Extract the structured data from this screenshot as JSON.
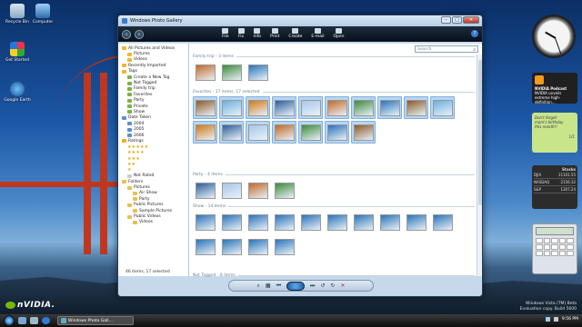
{
  "desktop": {
    "icons": [
      {
        "label": "Recycle Bin"
      },
      {
        "label": "Computer"
      },
      {
        "label": "Get Started"
      },
      {
        "label": "Google Earth"
      }
    ],
    "brand": "nVIDIA.",
    "watermark": [
      "Windows Vista (TM) Beta",
      "Evaluation copy. Build 5600"
    ]
  },
  "gadgets": {
    "podcast": {
      "title": "NVIDIA Podcast",
      "text": "NVIDIA unveils extreme high-definition..."
    },
    "note": {
      "lines": [
        "Don't forget",
        "mom's birthday",
        "this month!!"
      ],
      "pager": "1/1"
    },
    "stocks": {
      "title": "Stocks",
      "rows": [
        {
          "symbol": "DJIA",
          "value": "11101.55"
        },
        {
          "symbol": "NASDAQ",
          "value": "2156.32"
        },
        {
          "symbol": "S&P",
          "value": "1307.24"
        }
      ]
    }
  },
  "taskbar": {
    "active_task": "Windows Photo Gall...",
    "time": "9:56 PM"
  },
  "window": {
    "title": "Windows Photo Gallery",
    "help": "?",
    "toolbar": [
      {
        "label": "File",
        "icon": "file-icon"
      },
      {
        "label": "Fix",
        "icon": "fix-icon"
      },
      {
        "label": "Info",
        "icon": "info-icon"
      },
      {
        "label": "Print",
        "icon": "print-icon"
      },
      {
        "label": "Create",
        "icon": "create-icon"
      },
      {
        "label": "E-mail",
        "icon": "email-icon"
      },
      {
        "label": "Open",
        "icon": "open-icon"
      }
    ],
    "search_placeholder": "Search",
    "nav": {
      "items": [
        {
          "label": "All Pictures and Videos"
        },
        {
          "label": "Pictures"
        },
        {
          "label": "Videos"
        },
        {
          "label": "Recently Imported"
        },
        {
          "label": "Tags"
        },
        {
          "label": "Create a New Tag"
        },
        {
          "label": "Not Tagged"
        },
        {
          "label": "Family trip"
        },
        {
          "label": "Favorites"
        },
        {
          "label": "Party"
        },
        {
          "label": "Private"
        },
        {
          "label": "Show"
        },
        {
          "label": "Date Taken"
        },
        {
          "label": "2004"
        },
        {
          "label": "2005"
        },
        {
          "label": "2006"
        },
        {
          "label": "Ratings"
        },
        {
          "label": "★★★★★"
        },
        {
          "label": "★★★★"
        },
        {
          "label": "★★★"
        },
        {
          "label": "★★"
        },
        {
          "label": "★"
        },
        {
          "label": "Not Rated"
        },
        {
          "label": "Folders"
        },
        {
          "label": "Pictures"
        },
        {
          "label": "Air Show"
        },
        {
          "label": "Party"
        },
        {
          "label": "Public Pictures"
        },
        {
          "label": "Sample Pictures"
        },
        {
          "label": "Public Videos"
        },
        {
          "label": "Videos"
        }
      ],
      "status": "46 items, 17 selected"
    },
    "groups": [
      {
        "header": "Family trip - 3 items",
        "count": 3
      },
      {
        "header": "Favorites - 17 items, 17 selected",
        "count": 17
      },
      {
        "header": "Party - 4 items",
        "count": 4
      },
      {
        "header": "Show - 14 items",
        "count": 14
      },
      {
        "header": "Not Tagged - 8 items",
        "count": 0
      }
    ],
    "controls": [
      "zoom",
      "grid",
      "previous",
      "slideshow",
      "next",
      "rotate-left",
      "rotate-right",
      "delete"
    ]
  }
}
